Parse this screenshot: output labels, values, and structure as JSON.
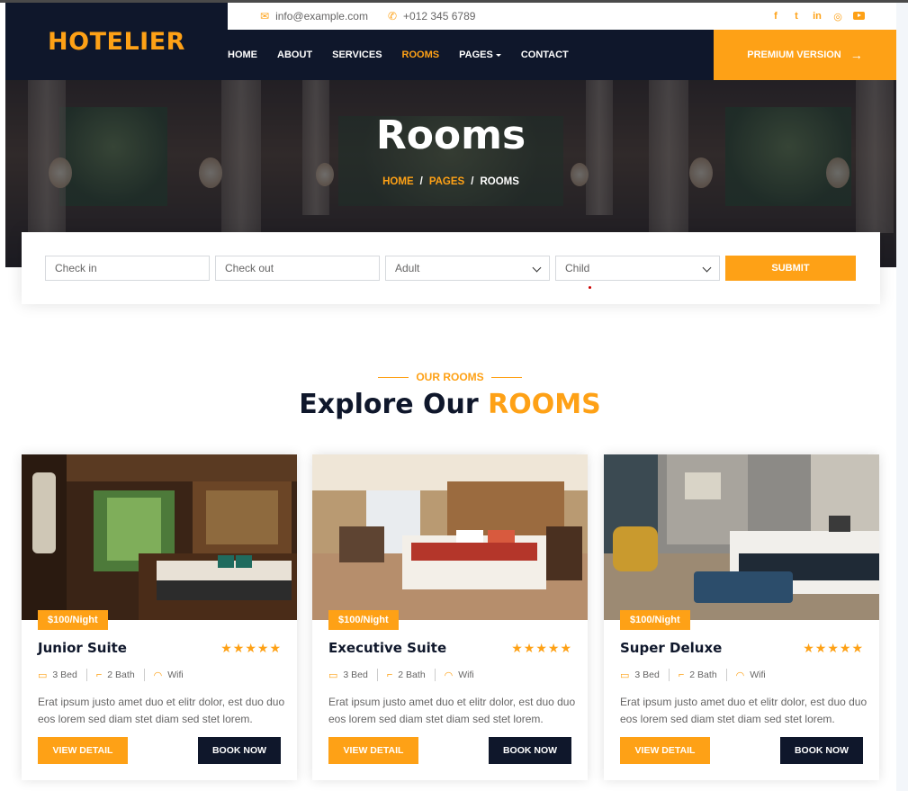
{
  "brand": {
    "name": "HOTELIER"
  },
  "topbar": {
    "email": "info@example.com",
    "phone": "+012 345 6789",
    "socials": [
      "facebook-icon",
      "twitter-icon",
      "linkedin-icon",
      "instagram-icon",
      "youtube-icon"
    ]
  },
  "nav": {
    "items": [
      {
        "label": "HOME"
      },
      {
        "label": "ABOUT"
      },
      {
        "label": "SERVICES"
      },
      {
        "label": "ROOMS"
      },
      {
        "label": "PAGES"
      },
      {
        "label": "CONTACT"
      }
    ],
    "active": "ROOMS",
    "premium_label": "PREMIUM VERSION"
  },
  "hero": {
    "title": "Rooms",
    "breadcrumb": [
      "HOME",
      "PAGES",
      "ROOMS"
    ]
  },
  "booking": {
    "checkin_placeholder": "Check in",
    "checkout_placeholder": "Check out",
    "adult_value": "Adult",
    "child_value": "Child",
    "submit_label": "SUBMIT"
  },
  "section": {
    "subtitle": "OUR ROOMS",
    "title_main": "Explore Our",
    "title_highlight": "ROOMS"
  },
  "rooms": [
    {
      "price": "$100/Night",
      "name": "Junior Suite",
      "stars": "★★★★★",
      "bed": "3 Bed",
      "bath": "2 Bath",
      "wifi": "Wifi",
      "description": "Erat ipsum justo amet duo et elitr dolor, est duo duo eos lorem sed diam stet diam sed stet lorem.",
      "detail_label": "VIEW DETAIL",
      "book_label": "BOOK NOW"
    },
    {
      "price": "$100/Night",
      "name": "Executive Suite",
      "stars": "★★★★★",
      "bed": "3 Bed",
      "bath": "2 Bath",
      "wifi": "Wifi",
      "description": "Erat ipsum justo amet duo et elitr dolor, est duo duo eos lorem sed diam stet diam sed stet lorem.",
      "detail_label": "VIEW DETAIL",
      "book_label": "BOOK NOW"
    },
    {
      "price": "$100/Night",
      "name": "Super Deluxe",
      "stars": "★★★★★",
      "bed": "3 Bed",
      "bath": "2 Bath",
      "wifi": "Wifi",
      "description": "Erat ipsum justo amet duo et elitr dolor, est duo duo eos lorem sed diam stet diam sed stet lorem.",
      "detail_label": "VIEW DETAIL",
      "book_label": "BOOK NOW"
    }
  ],
  "colors": {
    "accent": "#fea116",
    "dark": "#0f172b",
    "text": "#666565"
  }
}
